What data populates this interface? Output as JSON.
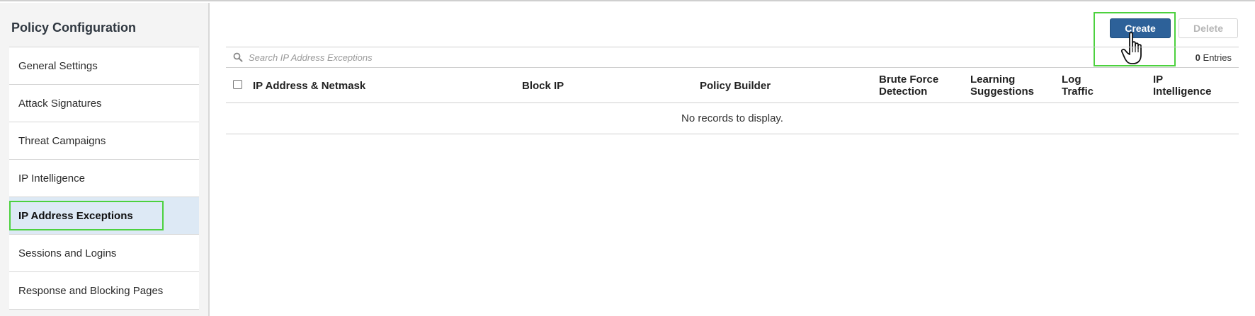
{
  "sidebar": {
    "title": "Policy Configuration",
    "items": [
      {
        "label": "General Settings"
      },
      {
        "label": "Attack Signatures"
      },
      {
        "label": "Threat Campaigns"
      },
      {
        "label": "IP Intelligence"
      },
      {
        "label": "IP Address Exceptions",
        "active": true
      },
      {
        "label": "Sessions and Logins"
      },
      {
        "label": "Response and Blocking Pages"
      }
    ]
  },
  "toolbar": {
    "create_label": "Create",
    "delete_label": "Delete"
  },
  "search": {
    "placeholder": "Search IP Address Exceptions",
    "entries_count": "0",
    "entries_label": "Entries"
  },
  "table": {
    "columns": [
      {
        "label": "IP Address & Netmask"
      },
      {
        "label": "Block IP"
      },
      {
        "label": "Policy Builder"
      },
      {
        "label": "Brute Force\nDetection"
      },
      {
        "label": "Learning\nSuggestions"
      },
      {
        "label": "Log\nTraffic"
      },
      {
        "label": "IP\nIntelligence"
      }
    ],
    "empty_message": "No records to display."
  },
  "colors": {
    "accent": "#2d6199",
    "highlight": "#4cd13e",
    "active_item_bg": "#dde9f5"
  },
  "icons": {
    "search": "search-icon",
    "cursor": "hand-pointer-icon"
  }
}
